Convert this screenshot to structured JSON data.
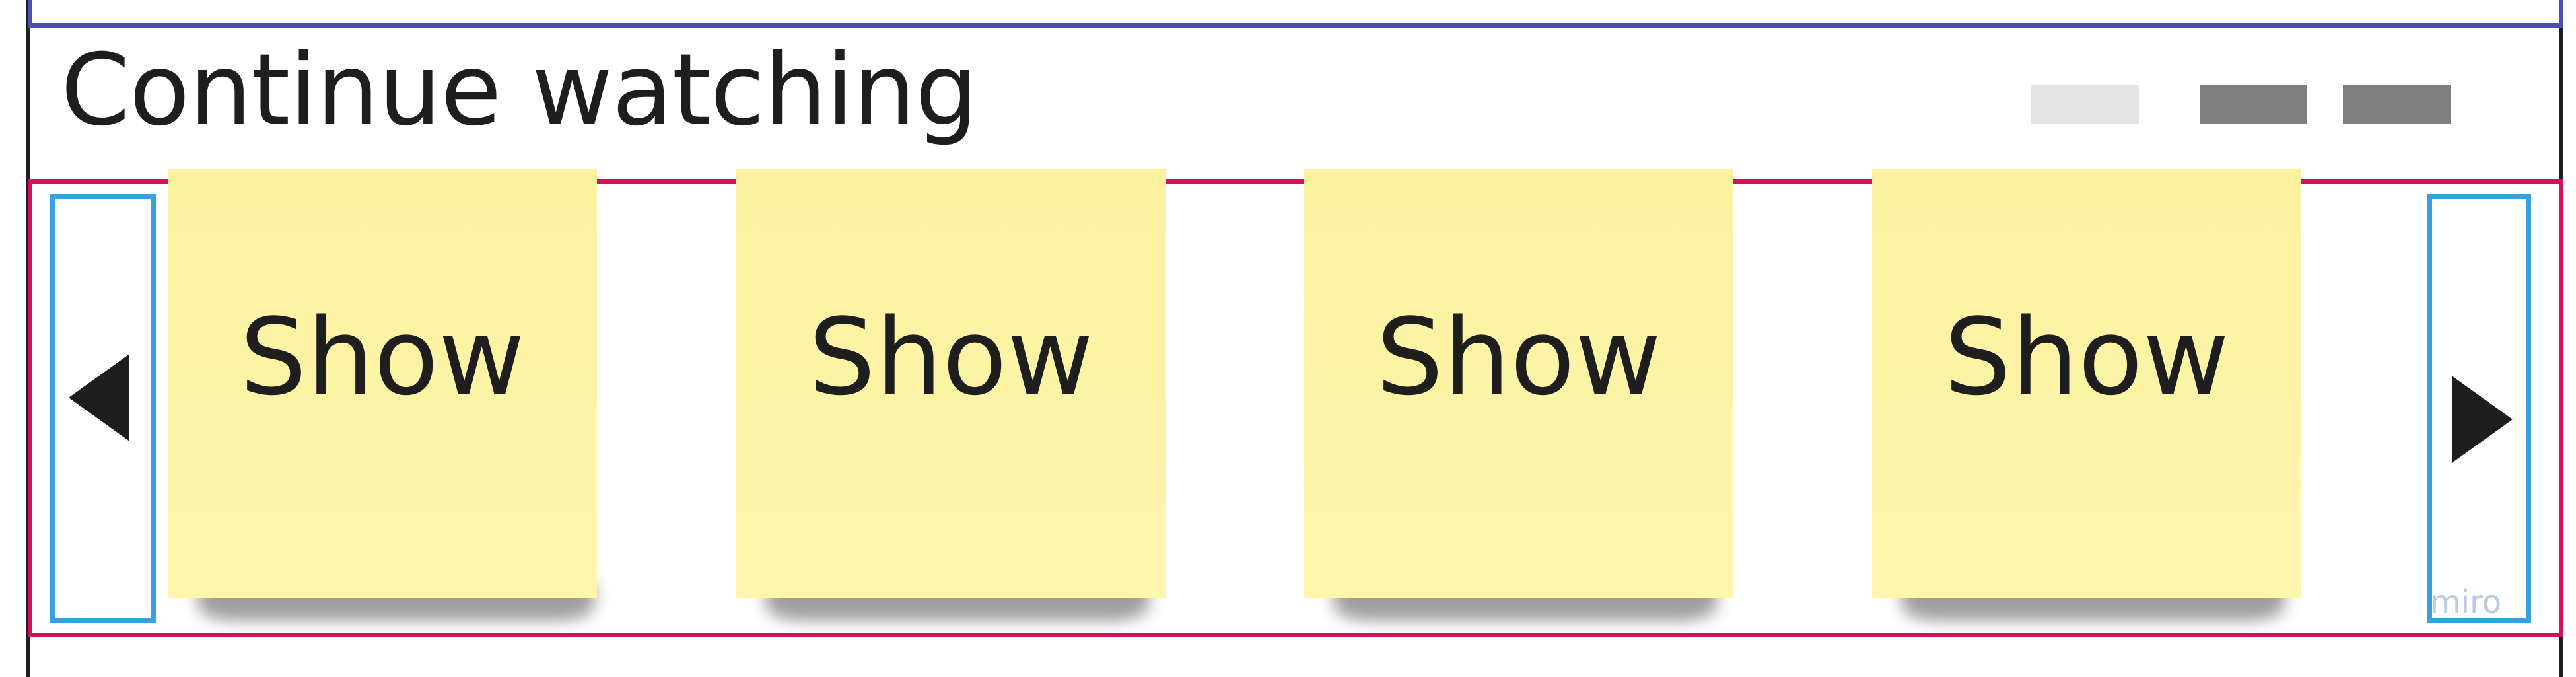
{
  "header": {
    "title": "Continue watching"
  },
  "pagination": {
    "dots": [
      {
        "state": "inactive",
        "color": "#e4e4e4"
      },
      {
        "state": "active",
        "color": "#808080"
      },
      {
        "state": "active",
        "color": "#808080"
      }
    ]
  },
  "carousel": {
    "prev_icon": "triangle-left-icon",
    "next_icon": "triangle-right-icon",
    "items": [
      {
        "label": "Show"
      },
      {
        "label": "Show"
      },
      {
        "label": "Show"
      },
      {
        "label": "Show"
      }
    ]
  },
  "watermark": "miro",
  "colors": {
    "note": "#fcf4a6",
    "carousel_border": "#d40f5c",
    "nav_border": "#38a0e4",
    "header_border": "#4a4fb5"
  }
}
